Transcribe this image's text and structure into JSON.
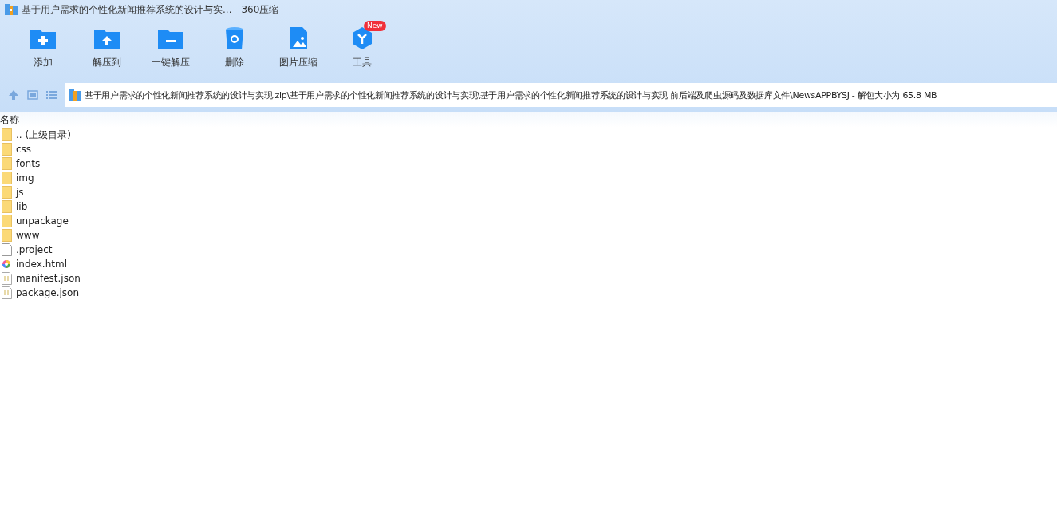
{
  "window": {
    "title": "基于用户需求的个性化新闻推荐系统的设计与实... - 360压缩"
  },
  "toolbar": [
    {
      "kind": "add",
      "label": "添加"
    },
    {
      "kind": "extract",
      "label": "解压到"
    },
    {
      "kind": "quick",
      "label": "一键解压"
    },
    {
      "kind": "delete",
      "label": "删除"
    },
    {
      "kind": "image",
      "label": "图片压缩"
    },
    {
      "kind": "tools",
      "label": "工具",
      "badge": "New"
    }
  ],
  "path": "基于用户需求的个性化新闻推荐系统的设计与实现.zip\\基于用户需求的个性化新闻推荐系统的设计与实现\\基于用户需求的个性化新闻推荐系统的设计与实现 前后端及爬虫源码及数据库文件\\NewsAPPBYSJ - 解包大小为 65.8 MB",
  "table": {
    "columns": [
      "名称"
    ],
    "rows": [
      {
        "kind": "folder",
        "name": ".. (上级目录)"
      },
      {
        "kind": "folder",
        "name": "css"
      },
      {
        "kind": "folder",
        "name": "fonts"
      },
      {
        "kind": "folder",
        "name": "img"
      },
      {
        "kind": "folder",
        "name": "js"
      },
      {
        "kind": "folder",
        "name": "lib"
      },
      {
        "kind": "folder",
        "name": "unpackage"
      },
      {
        "kind": "folder",
        "name": "www"
      },
      {
        "kind": "file",
        "name": ".project"
      },
      {
        "kind": "html",
        "name": "index.html"
      },
      {
        "kind": "json",
        "name": "manifest.json"
      },
      {
        "kind": "json",
        "name": "package.json"
      }
    ]
  }
}
